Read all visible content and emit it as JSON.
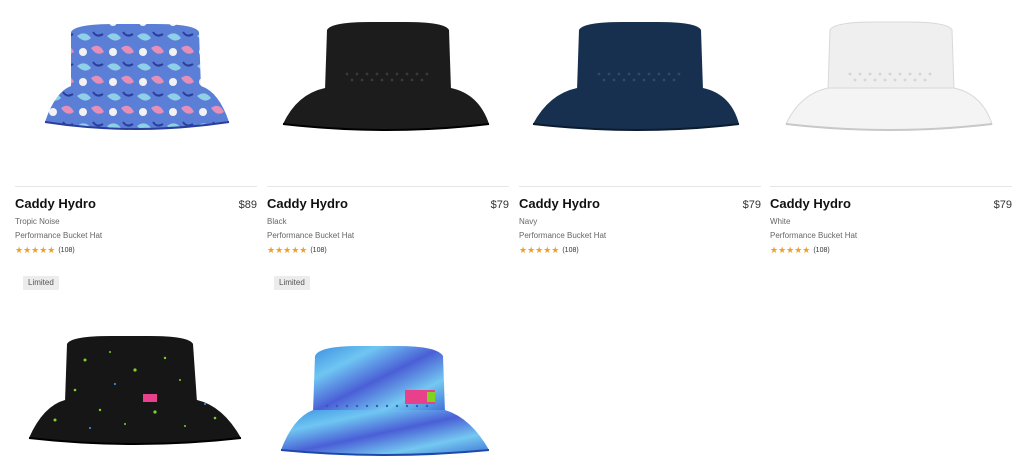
{
  "products": [
    {
      "name": "Caddy Hydro",
      "price": "$89",
      "color": "Tropic Noise",
      "type": "Performance Bucket Hat",
      "stars": "★★★★★",
      "reviews": "(108)"
    },
    {
      "name": "Caddy Hydro",
      "price": "$79",
      "color": "Black",
      "type": "Performance Bucket Hat",
      "stars": "★★★★★",
      "reviews": "(108)"
    },
    {
      "name": "Caddy Hydro",
      "price": "$79",
      "color": "Navy",
      "type": "Performance Bucket Hat",
      "stars": "★★★★★",
      "reviews": "(108)"
    },
    {
      "name": "Caddy Hydro",
      "price": "$79",
      "color": "White",
      "type": "Performance Bucket Hat",
      "stars": "★★★★★",
      "reviews": "(108)"
    }
  ],
  "badges": [
    "Limited",
    "Limited"
  ],
  "hat_colors": {
    "tropic": "#5b7fd6",
    "black": "#1c1c1c",
    "navy": "#17304f",
    "white": "#efefef",
    "splatter": "#161616",
    "tiedye": "#3b8fe0"
  },
  "accent": {
    "star": "#f0a02a"
  }
}
